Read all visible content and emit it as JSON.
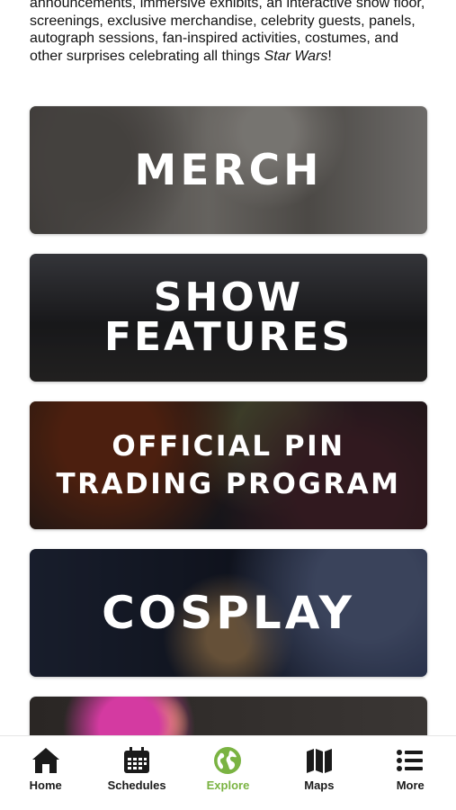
{
  "intro": {
    "text_main": "announcements, immersive exhibits, an interactive show floor, screenings, exclusive merchandise, celebrity guests, panels, autograph sessions, fan-inspired activities, costumes, and other surprises celebrating all things ",
    "text_italic": "Star Wars",
    "text_end": "!"
  },
  "cards": {
    "merch": "MERCH",
    "show_line1": "SHOW",
    "show_line2": "FEATURES",
    "pin_line1": "OFFICIAL PIN",
    "pin_line2": "TRADING PROGRAM",
    "cosplay": "COSPLAY"
  },
  "tabs": {
    "home": "Home",
    "schedules": "Schedules",
    "explore": "Explore",
    "maps": "Maps",
    "more": "More"
  },
  "colors": {
    "active_tab": "#7ab342",
    "text": "#1a1a1a"
  }
}
